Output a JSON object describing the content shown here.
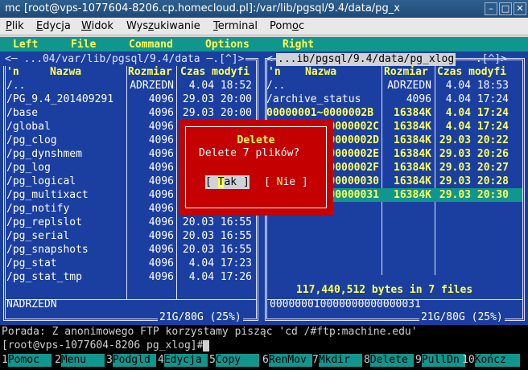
{
  "window": {
    "title": "mc [root@vps-1077604-8206.cp.homecloud.pl]:/var/lib/pgsql/9.4/data/pg_x",
    "buttons": {
      "minimize": "–",
      "maximize": "□",
      "close": "✕"
    }
  },
  "menubar": [
    "Plik",
    "Edycja",
    "Widok",
    "Wyszukiwanie",
    "Terminal",
    "Pomoc"
  ],
  "mc_menu": [
    "Left",
    "File",
    "Command",
    "Options",
    "Right"
  ],
  "left_panel": {
    "path": "<─ ...04/var/lib/pgsql/9.4/data ─.[^]>",
    "columns": {
      "n": "'n",
      "name": "Nazwa",
      "size": "Rozmiar",
      "time": "Czas modyfi"
    },
    "rows": [
      {
        "name": "/..",
        "size": "ADRZEDN",
        "time": "4.04 18:52"
      },
      {
        "name": "/PG_9.4_201409291",
        "size": "4096",
        "time": "29.03 20:00"
      },
      {
        "name": "/base",
        "size": "4096",
        "time": "29.03 20:00"
      },
      {
        "name": "/global",
        "size": "4096",
        "time": ""
      },
      {
        "name": "/pg_clog",
        "size": "4096",
        "time": ""
      },
      {
        "name": "/pg_dynshmem",
        "size": "4096",
        "time": ""
      },
      {
        "name": "/pg_log",
        "size": "4096",
        "time": ""
      },
      {
        "name": "/pg_logical",
        "size": "4096",
        "time": ""
      },
      {
        "name": "/pg_multixact",
        "size": "4096",
        "time": ""
      },
      {
        "name": "/pg_notify",
        "size": "4096",
        "time": ""
      },
      {
        "name": "/pg_replslot",
        "size": "4096",
        "time": "20.03 16:55"
      },
      {
        "name": "/pg_serial",
        "size": "4096",
        "time": "20.03 16:55"
      },
      {
        "name": "/pg_snapshots",
        "size": "4096",
        "time": "20.03 16:55"
      },
      {
        "name": "/pg_stat",
        "size": "4096",
        "time": "4.04 17:23"
      },
      {
        "name": "/pg_stat_tmp",
        "size": "4096",
        "time": "4.04 17:26"
      }
    ],
    "status": "NADRZEDN",
    "disk": "21G/80G (25%)"
  },
  "right_panel": {
    "path": "...ib/pgsql/9.4/data/pg_xlog",
    "path_suffix": "─.[^]>",
    "path_prefix": "<─",
    "columns": {
      "n": "'n",
      "name": "Nazwa",
      "size": "Rozmiar",
      "time": "Czas modyfi"
    },
    "rows": [
      {
        "name": "/..",
        "size": "ADRZEDN",
        "time": "4.04 18:53",
        "marked": false
      },
      {
        "name": "/archive_status",
        "size": "4096",
        "time": "4.04 17:24",
        "marked": false
      },
      {
        "name": " 00000001~0000002B",
        "size": "16384K",
        "time": "4.04 17:24",
        "marked": true
      },
      {
        "name": "0000002C",
        "size": "16384K",
        "time": "4.04 17:24",
        "marked": true
      },
      {
        "name": "0000002D",
        "size": "16384K",
        "time": "29.03 20:22",
        "marked": true
      },
      {
        "name": "0000002E",
        "size": "16384K",
        "time": "29.03 20:26",
        "marked": true
      },
      {
        "name": "0000002F",
        "size": "16384K",
        "time": "29.03 20:27",
        "marked": true
      },
      {
        "name": "00000030",
        "size": "16384K",
        "time": "29.03 20:28",
        "marked": true
      },
      {
        "name": "00000031",
        "size": "16384K",
        "time": "29.03 20:30",
        "marked": true
      }
    ],
    "summary": "117,440,512 bytes in 7 files",
    "status": "000000010000000000000031",
    "disk": "21G/80G (25%)"
  },
  "dialog": {
    "title": "Delete",
    "message": "Delete 7 plików?",
    "yes_left": "[ ",
    "yes_hot": "T",
    "yes_rest": "ak ]",
    "no_left": "[ ",
    "no_hot": "N",
    "no_rest": "ie ]"
  },
  "hint": "Porada: Z anonimowego FTP korzystamy pisząc 'cd /#ftp:machine.edu'",
  "prompt": "[root@vps-1077604-8206 pg_xlog]#",
  "fkeys": [
    {
      "num": "1",
      "label": "Pomoc"
    },
    {
      "num": "2",
      "label": "Menu"
    },
    {
      "num": "3",
      "label": "Podgld"
    },
    {
      "num": "4",
      "label": "Edycja"
    },
    {
      "num": "5",
      "label": "Copy"
    },
    {
      "num": "6",
      "label": "RenMov"
    },
    {
      "num": "7",
      "label": "Mkdir"
    },
    {
      "num": "8",
      "label": "Delete"
    },
    {
      "num": "9",
      "label": "PullDn"
    },
    {
      "num": "10",
      "label": "Kończ"
    }
  ],
  "colors": {
    "panel": "#1b3fa0",
    "accent": "#11968e",
    "highlight": "#ffff55",
    "dialog": "#c40000"
  }
}
